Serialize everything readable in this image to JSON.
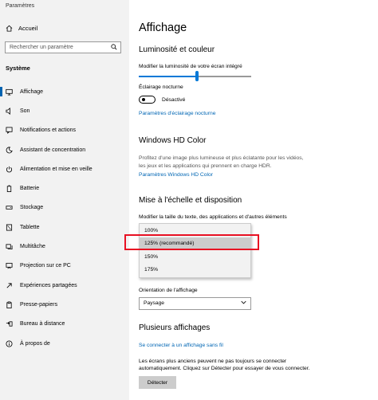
{
  "window": {
    "title": "Paramètres"
  },
  "sidebar": {
    "home_label": "Accueil",
    "search_placeholder": "Rechercher un paramètre",
    "section_title": "Système",
    "items": [
      {
        "label": "Affichage",
        "icon": "display-icon"
      },
      {
        "label": "Son",
        "icon": "speaker-icon"
      },
      {
        "label": "Notifications et actions",
        "icon": "notification-icon"
      },
      {
        "label": "Assistant de concentration",
        "icon": "moon-icon"
      },
      {
        "label": "Alimentation et mise en veille",
        "icon": "power-icon"
      },
      {
        "label": "Batterie",
        "icon": "battery-icon"
      },
      {
        "label": "Stockage",
        "icon": "storage-icon"
      },
      {
        "label": "Tablette",
        "icon": "tablet-icon"
      },
      {
        "label": "Multitâche",
        "icon": "multitask-icon"
      },
      {
        "label": "Projection sur ce PC",
        "icon": "projection-icon"
      },
      {
        "label": "Expériences partagées",
        "icon": "share-icon"
      },
      {
        "label": "Presse-papiers",
        "icon": "clipboard-icon"
      },
      {
        "label": "Bureau à distance",
        "icon": "remote-desktop-icon"
      },
      {
        "label": "À propos de",
        "icon": "info-icon"
      }
    ]
  },
  "main": {
    "title": "Affichage",
    "brightness": {
      "heading": "Luminosité et couleur",
      "slider_label": "Modifier la luminosité de votre écran intégré",
      "slider_value": 0.52,
      "night_light_label": "Éclairage nocturne",
      "toggle_state": "Désactivé",
      "night_light_link": "Paramètres d'éclairage nocturne"
    },
    "hdr": {
      "heading": "Windows HD Color",
      "description_line1": "Profitez d'une image plus lumineuse et plus éclatante pour les vidéos,",
      "description_line2": "les jeux et les applications qui prennent en charge HDR.",
      "link": "Paramètres Windows HD Color"
    },
    "scale": {
      "heading": "Mise à l'échelle et disposition",
      "label": "Modifier la taille du texte, des applications et d'autres éléments",
      "options": [
        "100%",
        "125% (recommandé)",
        "150%",
        "175%"
      ],
      "selected_index": 1
    },
    "orientation": {
      "label": "Orientation de l'affichage",
      "value": "Paysage"
    },
    "multi": {
      "heading": "Plusieurs affichages",
      "link": "Se connecter à un affichage sans fil",
      "description_line1": "Les écrans plus anciens peuvent ne pas toujours se connecter",
      "description_line2": "automatiquement. Cliquez sur Détecter pour essayer de vous connecter.",
      "detect_button": "Détecter"
    }
  },
  "colors": {
    "accent": "#0078d7",
    "link": "#0066b4",
    "highlight": "#e81123"
  }
}
